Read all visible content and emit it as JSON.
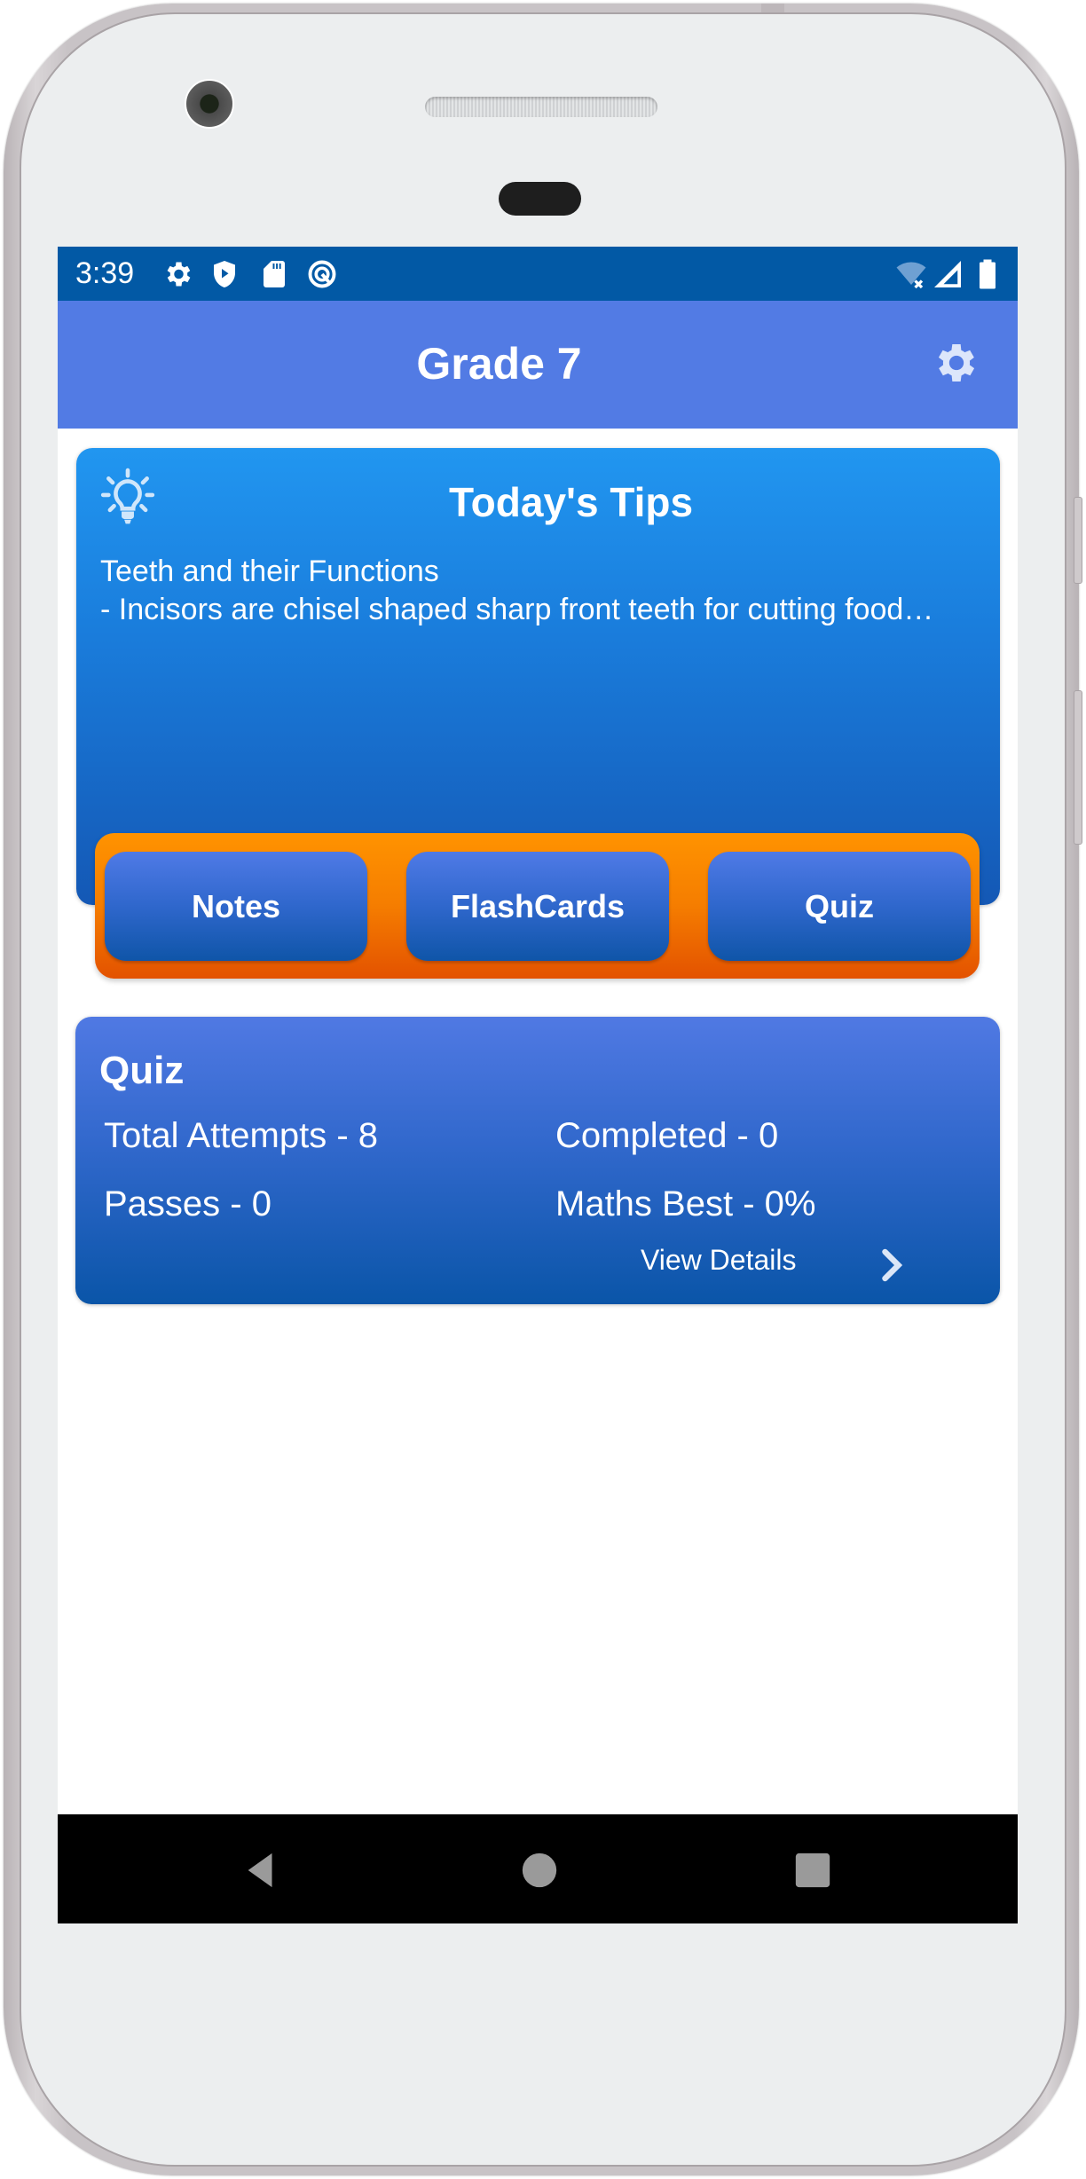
{
  "status_bar": {
    "time": "3:39",
    "left_icons": [
      "settings-icon",
      "shield-play-icon",
      "sd-card-icon",
      "at-sign-icon"
    ],
    "right_icons": [
      "wifi-off-icon",
      "cellular-signal-icon",
      "battery-icon"
    ]
  },
  "app_bar": {
    "title": "Grade 7",
    "settings_icon": "gear-icon"
  },
  "tips_card": {
    "icon": "lightbulb-icon",
    "title": "Today's Tips",
    "lines": [
      "Teeth and their Functions",
      "- Incisors are chisel shaped sharp front teeth for cutting food…"
    ],
    "actions": [
      {
        "label": "Notes"
      },
      {
        "label": "FlashCards"
      },
      {
        "label": "Quiz"
      }
    ]
  },
  "quiz_card": {
    "title": "Quiz",
    "stats": {
      "total_attempts": "Total Attempts - 8",
      "completed": "Completed - 0",
      "passes": "Passes - 0",
      "maths_best": "Maths Best - 0%"
    },
    "view_details_label": "View Details",
    "chevron_icon": "chevron-right-icon"
  },
  "nav_bar": {
    "buttons": [
      "back-icon",
      "home-icon",
      "recents-icon"
    ]
  },
  "colors": {
    "status_bar": "#0259a5",
    "app_bar": "#527be4",
    "tips_gradient_top": "#2196f0",
    "tips_gradient_bottom": "#1458b5",
    "action_strip_orange": "#f57d00",
    "action_button_blue": "#2f67cc",
    "quiz_gradient_top": "#5079e3",
    "quiz_gradient_bottom": "#0a55a8"
  }
}
